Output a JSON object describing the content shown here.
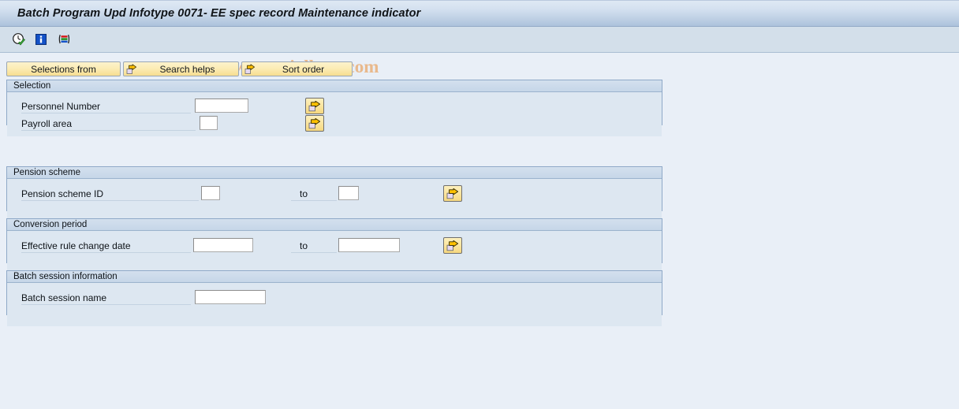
{
  "window": {
    "title": "Batch Program Upd Infotype 0071- EE spec record Maintenance indicator"
  },
  "watermark": {
    "copyright": "©",
    "text": "www.tutorialkart.com",
    "color": "#e9b98c"
  },
  "toolbar": {
    "icons": [
      {
        "name": "execute-clock-check-icon",
        "title": "Execute"
      },
      {
        "name": "information-icon",
        "title": "Information"
      },
      {
        "name": "variant-layout-icon",
        "title": "Get Variant"
      }
    ]
  },
  "tabs": [
    {
      "label": "Selections from",
      "has_arrow": false,
      "selected": true
    },
    {
      "label": "Search helps",
      "has_arrow": true,
      "selected": false
    },
    {
      "label": "Sort order",
      "has_arrow": true,
      "selected": false
    }
  ],
  "panels": [
    {
      "id": "selection",
      "title": "Selection",
      "rows": [
        {
          "label": "Personnel Number",
          "value": "",
          "to_label": "",
          "to_value": null,
          "has_arrow_button": true
        },
        {
          "label": "Payroll area",
          "value": "",
          "to_label": "",
          "to_value": null,
          "has_arrow_button": true
        }
      ]
    },
    {
      "id": "pension",
      "title": "Pension scheme",
      "rows": [
        {
          "label": "Pension scheme ID",
          "value": "",
          "to_label": "to",
          "to_value": "",
          "has_arrow_button": true
        }
      ]
    },
    {
      "id": "conversion",
      "title": "Conversion period",
      "rows": [
        {
          "label": "Effective rule change date",
          "value": "",
          "to_label": "to",
          "to_value": "",
          "has_arrow_button": true
        }
      ]
    },
    {
      "id": "batch",
      "title": "Batch session information",
      "rows": [
        {
          "label": "Batch session name",
          "value": "",
          "to_label": "",
          "to_value": null,
          "has_arrow_button": false
        }
      ]
    }
  ],
  "colors": {
    "titlebar_top": "#dfe9f4",
    "titlebar_bottom": "#acc2dc",
    "toolbar_band": "#d3dfea",
    "body_background": "#e9eff7",
    "panel_background": "#dde7f1",
    "panel_border": "#8fa9c8",
    "tab_yellow": "#fbeab0",
    "arrow_yellow": "#f6d87f"
  }
}
